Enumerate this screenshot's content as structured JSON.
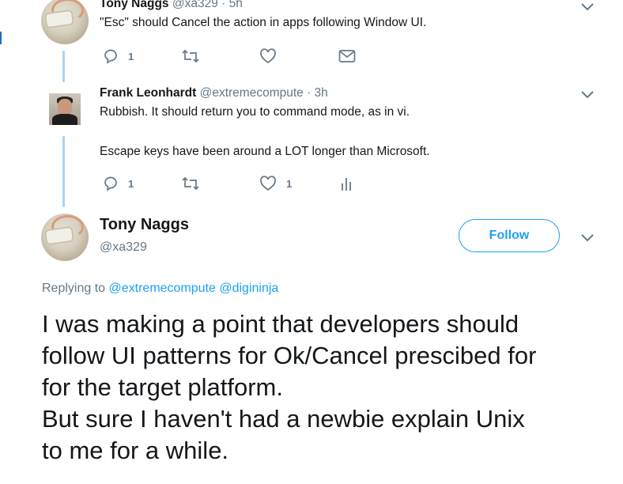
{
  "tweet1": {
    "name": "Tony Naggs",
    "handle": "@xa329 · 5h",
    "text": "\"Esc\" should Cancel the action in apps following Window UI.",
    "reply_count": "1"
  },
  "tweet2": {
    "name": "Frank Leonhardt",
    "handle": "@extremecompute · 3h",
    "text_line1": "Rubbish. It should return you to command mode, as in vi.",
    "text_line2": "Escape keys have been around a LOT longer than Microsoft.",
    "reply_count": "1",
    "like_count": "1"
  },
  "main_tweet": {
    "name": "Tony Naggs",
    "handle": "@xa329",
    "follow_label": "Follow",
    "replying_prefix": "Replying to",
    "replying_to_1": "@extremecompute",
    "replying_to_2": "@digininja",
    "lines": [
      "I was making a point that developers should",
      "follow UI patterns for Ok/Cancel prescibed for",
      "for the target platform.",
      "But sure I haven't had a newbie explain Unix",
      "to me for a while."
    ]
  },
  "icons": {
    "reply": "reply-icon",
    "retweet": "retweet-icon",
    "like": "heart-icon",
    "dm": "envelope-icon",
    "analytics": "analytics-icon",
    "more": "chevron-down-icon"
  },
  "colors": {
    "accent": "#1da1f2",
    "muted": "#657786",
    "thread_line": "#a9d4f2",
    "text": "#14171a"
  }
}
